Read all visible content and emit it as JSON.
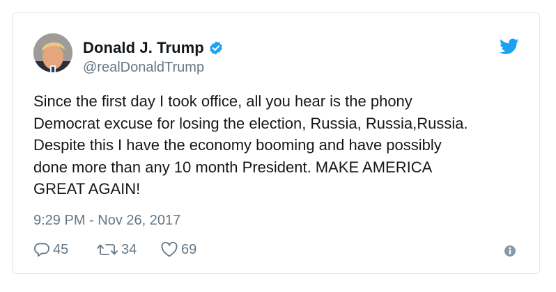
{
  "author": {
    "name": "Donald J. Trump",
    "handle": "@realDonaldTrump",
    "verified": true,
    "avatar": "profile-photo"
  },
  "tweet": {
    "lines": [
      "Since the first day I took office, all you hear is the phony",
      "Democrat excuse for losing the election, Russia, Russia,Russia.",
      "Despite this I have the economy booming and have possibly",
      "done more than any 10 month President. MAKE AMERICA",
      "GREAT AGAIN!"
    ],
    "timestamp": "9:29 PM - Nov 26, 2017"
  },
  "actions": {
    "replies": "45",
    "retweets": "34",
    "likes": "69"
  },
  "icons": {
    "brand": "twitter-bird-icon",
    "verified": "verified-badge-icon",
    "reply": "reply-icon",
    "retweet": "retweet-icon",
    "like": "heart-icon",
    "info": "info-icon"
  },
  "colors": {
    "twitter_blue": "#1da1f2",
    "text": "#14171a",
    "muted": "#657786",
    "border": "#e1e8ed"
  }
}
